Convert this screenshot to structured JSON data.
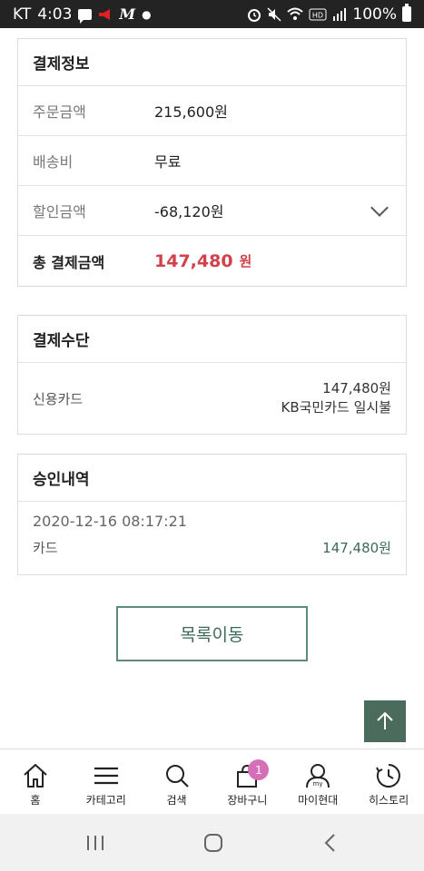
{
  "status_bar": {
    "carrier": "KT",
    "time": "4:03",
    "battery": "100%",
    "icons": [
      "message-icon",
      "megaphone-icon",
      "m-app-icon",
      "dot",
      "alarm-icon",
      "mute-icon",
      "wifi-icon",
      "hd-icon",
      "signal-icon",
      "battery-icon"
    ]
  },
  "payment_info": {
    "title": "결제정보",
    "rows": [
      {
        "label": "주문금액",
        "value": "215,600원"
      },
      {
        "label": "배송비",
        "value": "무료"
      },
      {
        "label": "할인금액",
        "value": "-68,120원"
      }
    ],
    "total": {
      "label": "총 결제금액",
      "value": "147,480",
      "unit": "원"
    }
  },
  "payment_method": {
    "title": "결제수단",
    "label": "신용카드",
    "amount": "147,480원",
    "detail": "KB국민카드 일시불"
  },
  "approval": {
    "title": "승인내역",
    "datetime": "2020-12-16 08:17:21",
    "type": "카드",
    "amount": "147,480원"
  },
  "list_button": "목록이동",
  "bottom_nav": {
    "home": "홈",
    "category": "카테고리",
    "search": "검색",
    "cart": "장바구니",
    "cart_count": "1",
    "my": "마이현대",
    "history": "히스토리"
  },
  "colors": {
    "accent_green": "#4b6b5c",
    "total_red": "#d1424b",
    "badge_pink": "#d66fb8"
  }
}
